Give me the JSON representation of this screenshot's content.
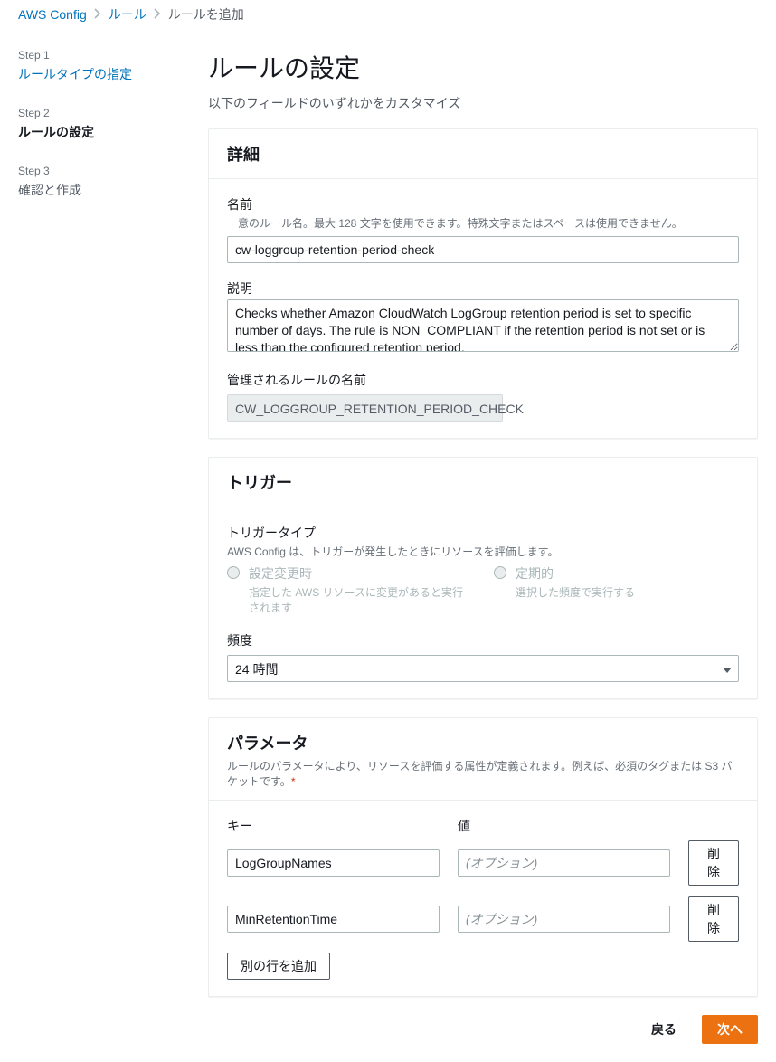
{
  "breadcrumb": {
    "root": "AWS Config",
    "middle": "ルール",
    "current": "ルールを追加"
  },
  "sidebar": {
    "steps": [
      {
        "label": "Step 1",
        "title": "ルールタイプの指定"
      },
      {
        "label": "Step 2",
        "title": "ルールの設定"
      },
      {
        "label": "Step 3",
        "title": "確認と作成"
      }
    ]
  },
  "page": {
    "title": "ルールの設定",
    "subtitle": "以下のフィールドのいずれかをカスタマイズ"
  },
  "details": {
    "header": "詳細",
    "name_label": "名前",
    "name_help": "一意のルール名。最大 128 文字を使用できます。特殊文字またはスペースは使用できません。",
    "name_value": "cw-loggroup-retention-period-check",
    "desc_label": "説明",
    "desc_value": "Checks whether Amazon CloudWatch LogGroup retention period is set to specific number of days. The rule is NON_COMPLIANT if the retention period is not set or is less than the configured retention period.",
    "managed_label": "管理されるルールの名前",
    "managed_value": "CW_LOGGROUP_RETENTION_PERIOD_CHECK"
  },
  "trigger": {
    "header": "トリガー",
    "type_label": "トリガータイプ",
    "type_help": "AWS Config は、トリガーが発生したときにリソースを評価します。",
    "opt1_title": "設定変更時",
    "opt1_help": "指定した AWS リソースに変更があると実行されます",
    "opt2_title": "定期的",
    "opt2_help": "選択した頻度で実行する",
    "freq_label": "頻度",
    "freq_value": "24 時間"
  },
  "params": {
    "header": "パラメータ",
    "help": "ルールのパラメータにより、リソースを評価する属性が定義されます。例えば、必須のタグまたは S3 バケットです。",
    "key_header": "キー",
    "value_header": "値",
    "value_placeholder": "(オプション)",
    "rows": [
      {
        "key": "LogGroupNames",
        "value": ""
      },
      {
        "key": "MinRetentionTime",
        "value": ""
      }
    ],
    "delete_label": "削除",
    "add_row_label": "別の行を追加"
  },
  "footer": {
    "back": "戻る",
    "next": "次へ"
  }
}
